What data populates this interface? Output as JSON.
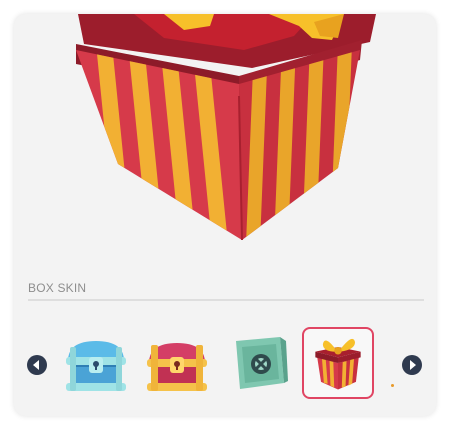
{
  "section": {
    "label": "BOX SKIN"
  },
  "skins": [
    {
      "icon": "blue-chest-icon",
      "selected": false
    },
    {
      "icon": "gold-chest-icon",
      "selected": false
    },
    {
      "icon": "safe-vault-icon",
      "selected": false
    },
    {
      "icon": "gift-box-icon",
      "selected": true
    }
  ],
  "nav": {
    "prev_icon": "chevron-left-icon",
    "next_icon": "chevron-right-icon"
  },
  "colors": {
    "accent": "#e04563",
    "panel_bg": "#f3f3f3",
    "nav_button": "#2f3a4f",
    "gift_red": "#d63a4a",
    "gift_stripe": "#f2b033",
    "ribbon": "#f7c02a"
  }
}
